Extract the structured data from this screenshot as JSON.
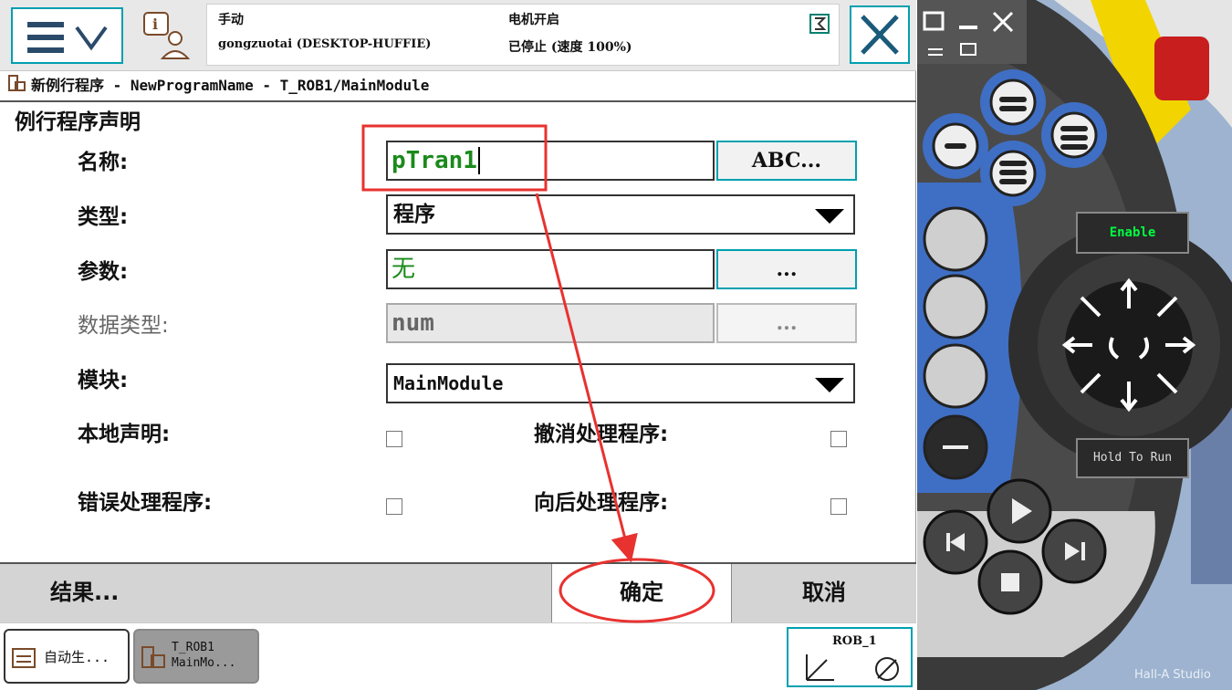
{
  "header": {
    "mode": "手动",
    "host": "gongzuotai (DESKTOP-HUFFIE)",
    "motor": "电机开启",
    "state": "已停止 (速度 100%)"
  },
  "title": "新例行程序 - NewProgramName - T_ROB1/MainModule",
  "section_header": "例行程序声明",
  "form": {
    "name_label": "名称:",
    "name_value": "pTran1",
    "name_button": "ABC...",
    "type_label": "类型:",
    "type_value": "程序",
    "params_label": "参数:",
    "params_value": "无",
    "params_button": "...",
    "datatype_label": "数据类型:",
    "datatype_value": "num",
    "datatype_button": "...",
    "module_label": "模块:",
    "module_value": "MainModule",
    "local_label": "本地声明:",
    "undo_label": "撤消处理程序:",
    "error_label": "错误处理程序:",
    "backward_label": "向后处理程序:"
  },
  "bottom": {
    "result": "结果...",
    "ok": "确定",
    "cancel": "取消"
  },
  "taskbar": {
    "task1": "自动生...",
    "task2_line1": "T_ROB1",
    "task2_line2": "MainMo...",
    "rob": "ROB_1"
  },
  "pendant": {
    "enable": "Enable",
    "hold_to_run": "Hold To Run",
    "watermark": "Hall-A Studio"
  },
  "colors": {
    "accent": "#00a0b0",
    "annotation": "#e8322f",
    "value_green": "#1a8a1a",
    "pendant_blue": "#3f6fc4"
  }
}
